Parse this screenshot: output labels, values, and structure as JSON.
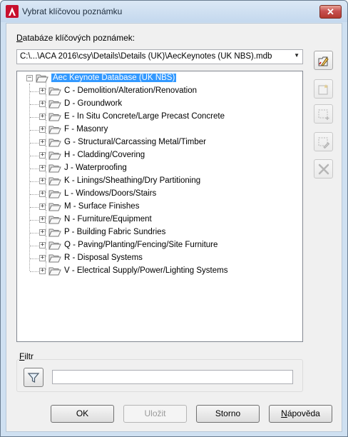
{
  "window": {
    "title": "Vybrat klíčovou poznámku"
  },
  "database_label": {
    "prefix": "D",
    "rest": "atabáze klíčových poznámek:"
  },
  "database_combo": {
    "value": "C:\\...\\ACA 2016\\csy\\Details\\Details (UK)\\AecKeynotes (UK NBS).mdb"
  },
  "tree": {
    "root": "Aec Keynote Database (UK NBS)",
    "items": [
      "C - Demolition/Alteration/Renovation",
      "D - Groundwork",
      "E - In Situ Concrete/Large Precast Concrete",
      "F - Masonry",
      "G - Structural/Carcassing Metal/Timber",
      "H - Cladding/Covering",
      "J - Waterproofing",
      "K - Linings/Sheathing/Dry Partitioning",
      "L - Windows/Doors/Stairs",
      "M - Surface Finishes",
      "N - Furniture/Equipment",
      "P - Building Fabric Sundries",
      "Q - Paving/Planting/Fencing/Site Furniture",
      "R - Disposal Systems",
      "V - Electrical Supply/Power/Lighting Systems"
    ]
  },
  "filter": {
    "label_prefix": "F",
    "label_rest": "iltr",
    "value": ""
  },
  "buttons": {
    "ok": "OK",
    "save": "Uložit",
    "cancel": "Storno",
    "help_prefix": "N",
    "help_rest": "ápověda"
  },
  "icons": {
    "app": "autocad-logo-icon",
    "toolbar": [
      "open-database-icon",
      "new-keynote-icon",
      "add-selection-icon",
      "edit-selection-icon",
      "delete-icon"
    ]
  }
}
